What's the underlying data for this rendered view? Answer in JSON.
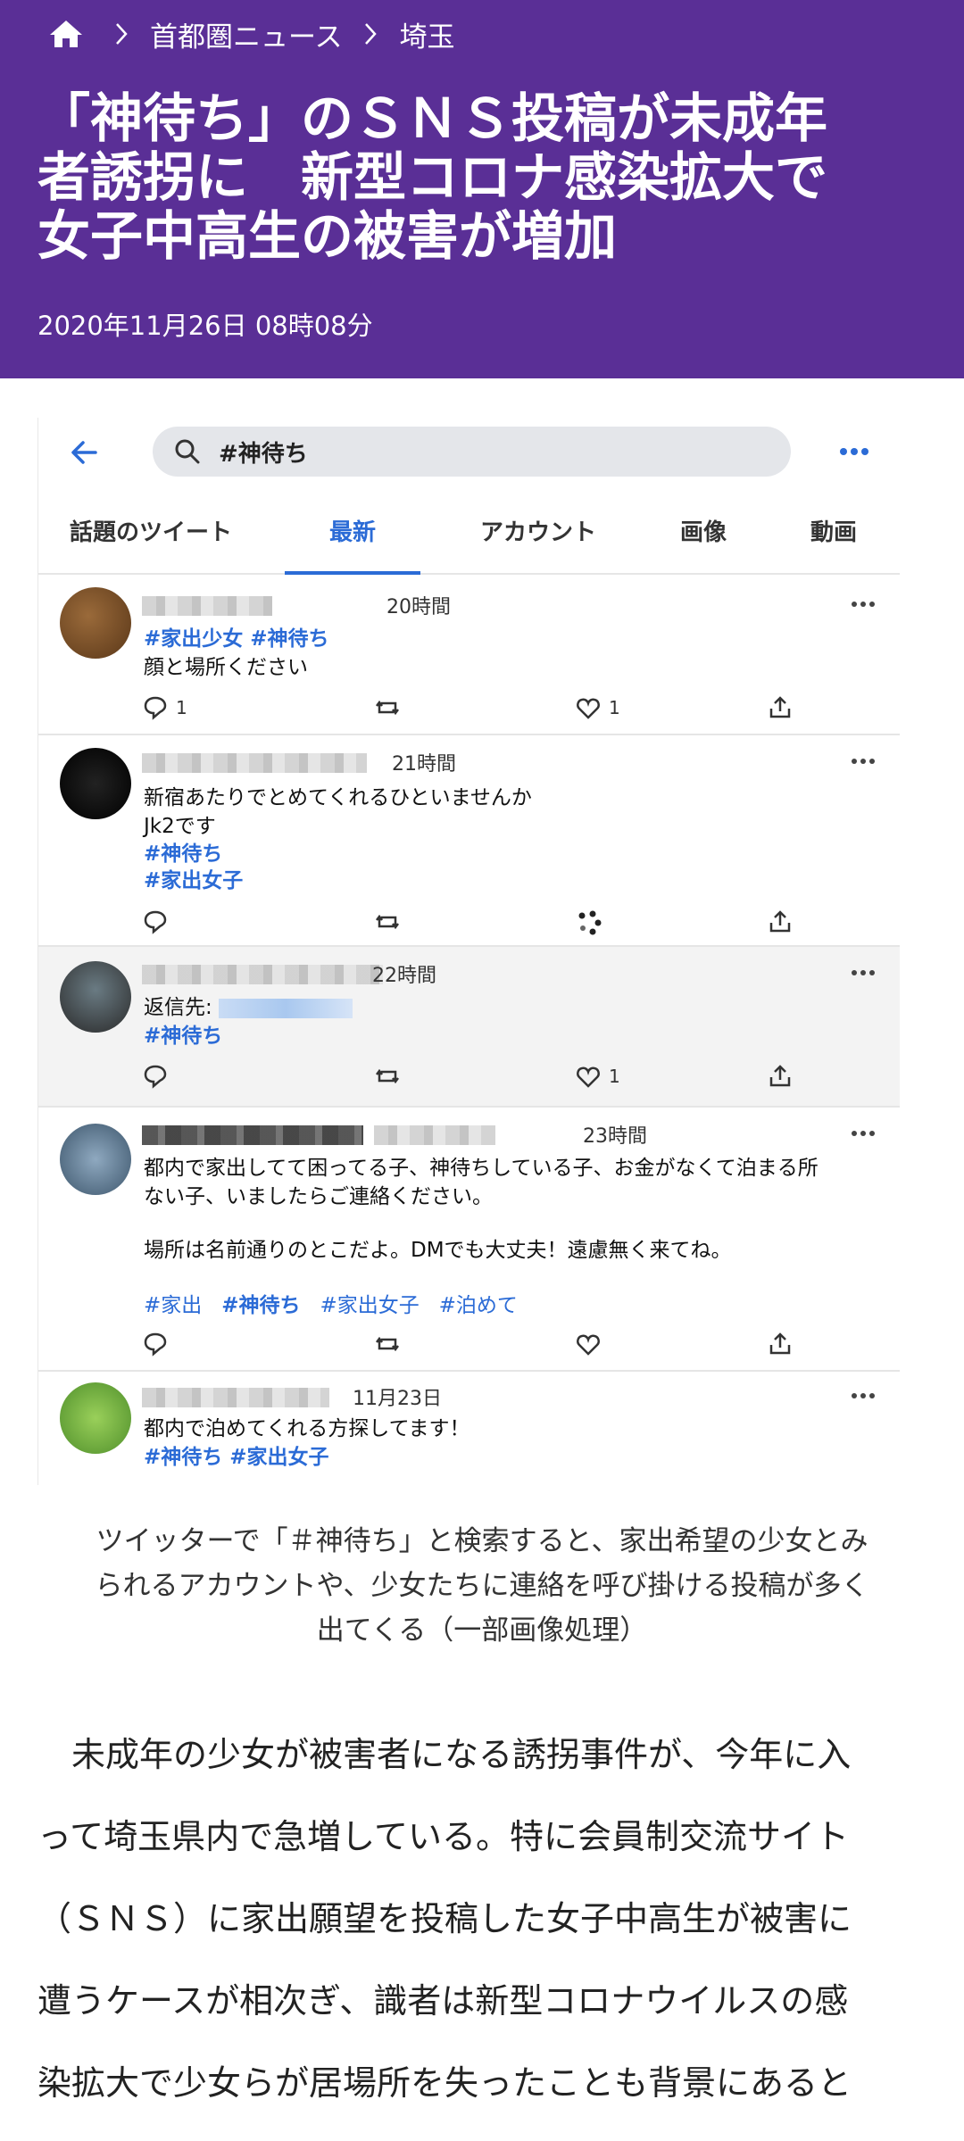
{
  "breadcrumb": {
    "items": [
      "首都圏ニュース",
      "埼玉"
    ]
  },
  "headline": {
    "lines": [
      "「神待ち」のＳＮＳ投稿が未成年",
      "者誘拐に　新型コロナ感染拡大で",
      "女子中高生の被害が増加"
    ]
  },
  "date": "2020年11月26日 08時08分",
  "image": {
    "search_query": "#神待ち",
    "tabs": [
      "話題のツイート",
      "最新",
      "アカウント",
      "画像",
      "動画"
    ],
    "active_tab": "最新",
    "tweets": [
      {
        "time": "20時間",
        "lines": [
          "#家出少女 #神待ち",
          "顔と場所ください"
        ],
        "reply_count": "1",
        "like_count": "1"
      },
      {
        "time": "21時間",
        "lines": [
          "新宿あたりでとめてくれるひといませんか",
          "Jk2です",
          "#神待ち",
          "#家出女子"
        ],
        "reply_count": "",
        "like_count": ""
      },
      {
        "time": "22時間",
        "reply_label": "返信先:",
        "lines": [
          "#神待ち"
        ],
        "reply_count": "",
        "like_count": "1"
      },
      {
        "time": "23時間",
        "lines": [
          "都内で家出してて困ってる子、神待ちしている子、お金がなくて泊まる所",
          "ない子、いましたらご連絡ください。",
          "",
          "場所は名前通りのとこだよ。DMでも大丈夫！遠慮無く来てね。"
        ],
        "hashtags": [
          "#家出",
          "#神待ち",
          "#家出女子",
          "#泊めて"
        ],
        "reply_count": "",
        "like_count": ""
      },
      {
        "time": "11月23日",
        "lines": [
          "都内で泊めてくれる方探してます！",
          "#神待ち #家出女子"
        ]
      }
    ]
  },
  "caption": [
    "ツイッターで「＃神待ち」と検索すると、家出希望の少女とみ",
    "られるアカウントや、少女たちに連絡を呼び掛ける投稿が多く",
    "出てくる（一部画像処理）"
  ],
  "body": [
    "　未成年の少女が被害者になる誘拐事件が、今年に入",
    "って埼玉県内で急増している。特に会員制交流サイト",
    "（ＳＮＳ）に家出願望を投稿した女子中高生が被害に",
    "遭うケースが相次ぎ、識者は新型コロナウイルスの感",
    "染拡大で少女らが居場所を失ったことも背景にあると"
  ],
  "colors": {
    "header_bg": "#5a2f96",
    "link_blue": "#2b6bd6"
  },
  "icons": [
    "home-icon",
    "chevron-right-icon",
    "back-arrow-icon",
    "search-icon",
    "more-icon",
    "reply-icon",
    "retweet-icon",
    "like-icon",
    "share-icon"
  ]
}
